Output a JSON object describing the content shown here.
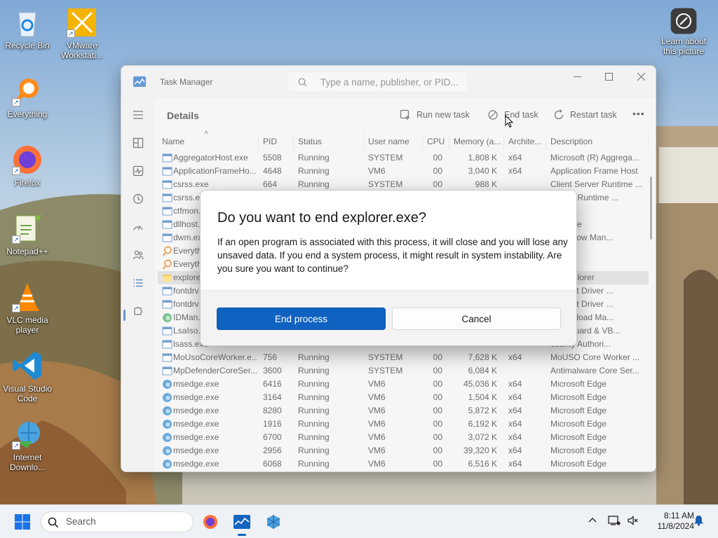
{
  "desktop": {
    "icons": [
      {
        "name": "Recycle Bin"
      },
      {
        "name": "VMware Workstati..."
      },
      {
        "name": "Everything"
      },
      {
        "name": "Firefox"
      },
      {
        "name": "Notepad++"
      },
      {
        "name": "VLC media player"
      },
      {
        "name": "Visual Studio Code"
      },
      {
        "name": "Internet Downlo..."
      }
    ],
    "learn_picture": "Learn about this picture"
  },
  "task_manager": {
    "title": "Task Manager",
    "search_placeholder": "Type a name, publisher, or PID...",
    "section_title": "Details",
    "toolbar": {
      "run_new_task": "Run new task",
      "end_task": "End task",
      "restart_task": "Restart task",
      "more": "•••"
    },
    "columns": [
      "Name",
      "PID",
      "Status",
      "User name",
      "CPU",
      "Memory (a...",
      "Archite...",
      "Description"
    ],
    "rows": [
      {
        "name": "AggregatorHost.exe",
        "pid": "5508",
        "status": "Running",
        "user": "SYSTEM",
        "cpu": "00",
        "mem": "1,808 K",
        "arch": "x64",
        "desc": "Microsoft (R) Aggrega..."
      },
      {
        "name": "ApplicationFrameHo...",
        "pid": "4648",
        "status": "Running",
        "user": "VM6",
        "cpu": "00",
        "mem": "3,040 K",
        "arch": "x64",
        "desc": "Application Frame Host"
      },
      {
        "name": "csrss.exe",
        "pid": "664",
        "status": "Running",
        "user": "SYSTEM",
        "cpu": "00",
        "mem": "988 K",
        "arch": "",
        "desc": "Client Server Runtime ..."
      },
      {
        "name": "csrss.exe",
        "pid": "",
        "status": "",
        "user": "",
        "cpu": "",
        "mem": "",
        "arch": "",
        "desc": "Server Runtime ..."
      },
      {
        "name": "ctfmon.",
        "pid": "",
        "status": "",
        "user": "",
        "cpu": "",
        "mem": "",
        "arch": "",
        "desc": "oader"
      },
      {
        "name": "dllhost.",
        "pid": "",
        "status": "",
        "user": "",
        "cpu": "",
        "mem": "",
        "arch": "",
        "desc": "urrogate"
      },
      {
        "name": "dwm.ex",
        "pid": "",
        "status": "",
        "user": "",
        "cpu": "",
        "mem": "",
        "arch": "",
        "desc": "p Window Man..."
      },
      {
        "name": "Everythi",
        "pid": "",
        "status": "",
        "user": "",
        "cpu": "",
        "mem": "",
        "arch": "",
        "desc": "ing"
      },
      {
        "name": "Everythi",
        "pid": "",
        "status": "",
        "user": "",
        "cpu": "",
        "mem": "",
        "arch": "",
        "desc": "ing"
      },
      {
        "name": "explorer",
        "pid": "",
        "status": "",
        "user": "",
        "cpu": "",
        "mem": "",
        "arch": "",
        "desc": "ws Explorer"
      },
      {
        "name": "fontdrv",
        "pid": "",
        "status": "",
        "user": "",
        "cpu": "",
        "mem": "",
        "arch": "",
        "desc": "de Font Driver ..."
      },
      {
        "name": "fontdrv",
        "pid": "",
        "status": "",
        "user": "",
        "cpu": "",
        "mem": "",
        "arch": "",
        "desc": "de Font Driver ..."
      },
      {
        "name": "IDMan.e",
        "pid": "",
        "status": "",
        "user": "",
        "cpu": "",
        "mem": "",
        "arch": "",
        "desc": "t Download Ma..."
      },
      {
        "name": "LsaIso.e",
        "pid": "",
        "status": "",
        "user": "",
        "cpu": "",
        "mem": "",
        "arch": "",
        "desc": "ntial Guard & VB..."
      },
      {
        "name": "lsass.exe",
        "pid": "",
        "status": "",
        "user": "",
        "cpu": "",
        "mem": "",
        "arch": "",
        "desc": "ecurity Authori..."
      },
      {
        "name": "MoUsoCoreWorker.e...",
        "pid": "756",
        "status": "Running",
        "user": "SYSTEM",
        "cpu": "00",
        "mem": "7,628 K",
        "arch": "x64",
        "desc": "MoUSO Core Worker ..."
      },
      {
        "name": "MpDefenderCoreSer...",
        "pid": "3600",
        "status": "Running",
        "user": "SYSTEM",
        "cpu": "00",
        "mem": "6,084 K",
        "arch": "",
        "desc": "Antimalware Core Ser..."
      },
      {
        "name": "msedge.exe",
        "pid": "6416",
        "status": "Running",
        "user": "VM6",
        "cpu": "00",
        "mem": "45,036 K",
        "arch": "x64",
        "desc": "Microsoft Edge"
      },
      {
        "name": "msedge.exe",
        "pid": "3164",
        "status": "Running",
        "user": "VM6",
        "cpu": "00",
        "mem": "1,504 K",
        "arch": "x64",
        "desc": "Microsoft Edge"
      },
      {
        "name": "msedge.exe",
        "pid": "8280",
        "status": "Running",
        "user": "VM6",
        "cpu": "00",
        "mem": "5,872 K",
        "arch": "x64",
        "desc": "Microsoft Edge"
      },
      {
        "name": "msedge.exe",
        "pid": "1916",
        "status": "Running",
        "user": "VM6",
        "cpu": "00",
        "mem": "6,192 K",
        "arch": "x64",
        "desc": "Microsoft Edge"
      },
      {
        "name": "msedge.exe",
        "pid": "6700",
        "status": "Running",
        "user": "VM6",
        "cpu": "00",
        "mem": "3,072 K",
        "arch": "x64",
        "desc": "Microsoft Edge"
      },
      {
        "name": "msedge.exe",
        "pid": "2956",
        "status": "Running",
        "user": "VM6",
        "cpu": "00",
        "mem": "39,320 K",
        "arch": "x64",
        "desc": "Microsoft Edge"
      },
      {
        "name": "msedge.exe",
        "pid": "6068",
        "status": "Running",
        "user": "VM6",
        "cpu": "00",
        "mem": "6,516 K",
        "arch": "x64",
        "desc": "Microsoft Edge"
      }
    ]
  },
  "dialog": {
    "title": "Do you want to end explorer.exe?",
    "body": "If an open program is associated with this process, it will close and you will lose any unsaved data. If you end a system process, it might result in system instability. Are you sure you want to continue?",
    "primary": "End process",
    "secondary": "Cancel"
  },
  "taskbar": {
    "search": "Search",
    "time": "8:11 AM",
    "date": "11/8/2024"
  },
  "colors": {
    "accent": "#0f62c0",
    "selected_row": "#d3d3d3"
  }
}
